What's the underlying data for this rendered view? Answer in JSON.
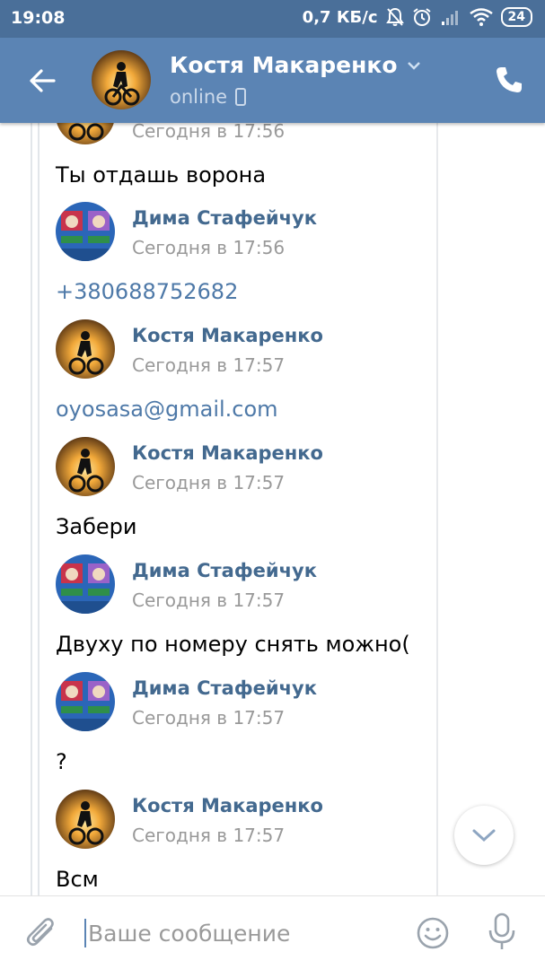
{
  "status_bar": {
    "time": "19:08",
    "speed": "0,7 КБ/с",
    "battery": "24",
    "icons": [
      "mute-bell-icon",
      "alarm-icon",
      "signal-icon",
      "wifi-icon",
      "battery-icon"
    ]
  },
  "header": {
    "contact_name": "Костя Макаренко",
    "status": "online",
    "icons": [
      "back-arrow-icon",
      "chevron-down-icon",
      "mobile-icon",
      "phone-icon"
    ]
  },
  "messages": [
    {
      "author": "",
      "time": "Сегодня в 17:56",
      "text": "Ты отдашь ворона",
      "avatar": "kostya"
    },
    {
      "author": "Дима Стафейчук",
      "time": "Сегодня в 17:56",
      "text": "+380688752682",
      "avatar": "dima",
      "link": true
    },
    {
      "author": "Костя Макаренко",
      "time": "Сегодня в 17:57",
      "text": "oyosasa@gmail.com",
      "avatar": "kostya",
      "link": true
    },
    {
      "author": "Костя Макаренко",
      "time": "Сегодня в 17:57",
      "text": "Забери",
      "avatar": "kostya"
    },
    {
      "author": "Дима Стафейчук",
      "time": "Сегодня в 17:57",
      "text": "Двуху по номеру снять можно(",
      "avatar": "dima"
    },
    {
      "author": "Дима Стафейчук",
      "time": "Сегодня в 17:57",
      "text": "?",
      "avatar": "dima"
    },
    {
      "author": "Костя Макаренко",
      "time": "Сегодня в 17:57",
      "text": "Всм",
      "avatar": "kostya"
    }
  ],
  "composer": {
    "placeholder": "Ваше сообщение",
    "icons": [
      "paperclip-icon",
      "smile-icon",
      "microphone-icon"
    ]
  },
  "colors": {
    "status_bar": "#4a6f99",
    "header": "#5b84b4",
    "author": "#43698f",
    "link": "#4e79a8"
  }
}
